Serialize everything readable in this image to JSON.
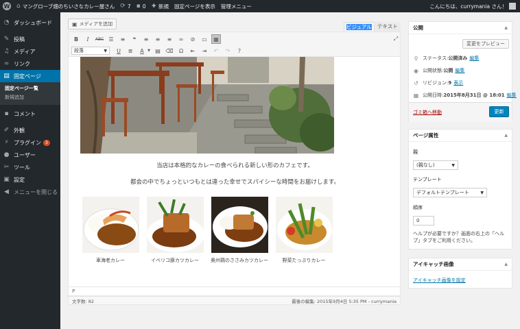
{
  "adminbar": {
    "site_name": "マングローブ畑のちいさなカレー屋さん",
    "updates_count": "7",
    "comments_count": "0",
    "new_label": "新規",
    "view_page_label": "固定ページを表示",
    "admin_menu_label": "管理メニュー",
    "greeting": "こんにちは、currymania さん！"
  },
  "sidebar": {
    "dashboard": "ダッシュボード",
    "posts": "投稿",
    "media": "メディア",
    "links": "リンク",
    "pages": "固定ページ",
    "pages_all": "固定ページ一覧",
    "pages_new": "新規追加",
    "comments": "コメント",
    "appearance": "外観",
    "plugins": "プラグイン",
    "plugins_badge": "3",
    "users": "ユーザー",
    "tools": "ツール",
    "settings": "設定",
    "collapse": "メニューを閉じる"
  },
  "editor": {
    "add_media": "メディアを追加",
    "tab_visual": "ビジュアル",
    "tab_text": "テキスト",
    "format_select": "段落",
    "caption1": "当店は本格的なカレーの食べられる新しい形のカフェです。",
    "caption2": "都会の中でちょっといつもとは違った幸せでスパイシーな時間をお届けします。",
    "dishes": [
      {
        "label": "車海老カレー"
      },
      {
        "label": "イベリコ豚カツカレー"
      },
      {
        "label": "奥州鶏のささみカツカレー"
      },
      {
        "label": "野菜たっぷりカレー"
      }
    ],
    "path": "P",
    "word_count": "文字数: 82",
    "last_edited": "最後の編集: 2015年9月4日 5:35 PM - currymania"
  },
  "publish": {
    "title": "公開",
    "preview_button": "変更をプレビュー",
    "status_label": "ステータス: ",
    "status_value": "公開済み",
    "visibility_label": "公開状態: ",
    "visibility_value": "公開",
    "revisions_label": "リビジョン: ",
    "revisions_value": "9",
    "revisions_link": "表示",
    "date_label": "公開日時: ",
    "date_value": "2015年8月31日 @ 18:01",
    "edit_link": "編集",
    "trash_link": "ゴミ箱へ移動",
    "update_button": "更新"
  },
  "page_attributes": {
    "title": "ページ属性",
    "parent_label": "親",
    "parent_value": "(親なし)",
    "template_label": "テンプレート",
    "template_value": "デフォルトテンプレート",
    "order_label": "順序",
    "order_value": "0",
    "help_text": "ヘルプが必要ですか？画面の右上の「ヘルプ」タブをご利用ください。"
  },
  "featured_image": {
    "title": "アイキャッチ画像",
    "set_link": "アイキャッチ画像を設定"
  },
  "colors": {
    "admin_bar": "#23282d",
    "menu_current": "#0073aa",
    "primary_button": "#0085ba",
    "trash_link": "#a00"
  }
}
